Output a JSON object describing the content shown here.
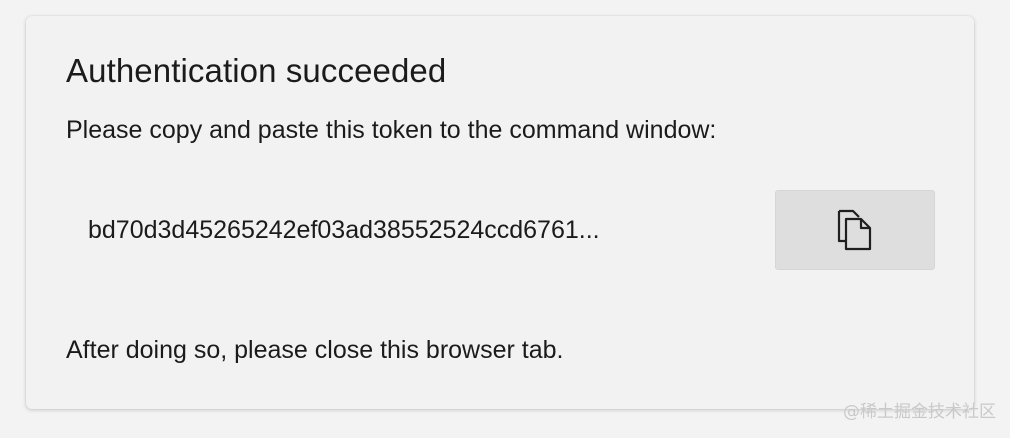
{
  "dialog": {
    "title": "Authentication succeeded",
    "instruction": "Please copy and paste this token to the command window:",
    "token": "bd70d3d45265242ef03ad38552524ccd6761...",
    "copy_button": {
      "icon": "copy-icon"
    },
    "footer_note": "After doing so, please close this browser tab."
  },
  "watermark": {
    "text": "@稀土掘金技术社区"
  }
}
